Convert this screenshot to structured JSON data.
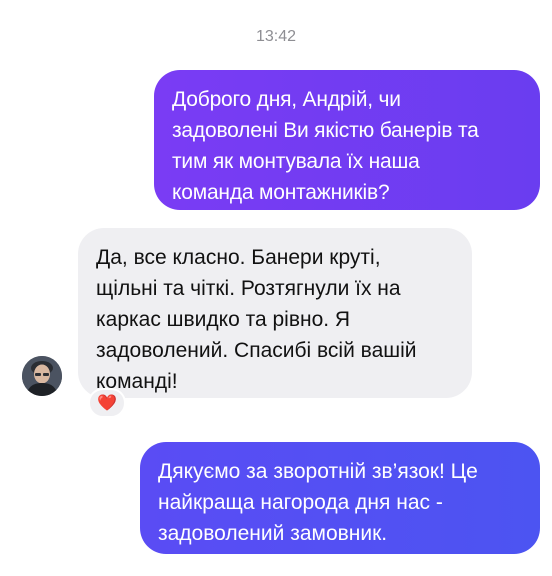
{
  "timestamp": "13:42",
  "messages": [
    {
      "direction": "outgoing",
      "text": "Доброго дня, Андрій, чи\nзадоволені Ви якістю банерів та\nтим як монтувала їх наша\nкоманда монтажників?"
    },
    {
      "direction": "incoming",
      "text": "Да, все класно. Банери круті,\nщільні та чіткі. Розтягнули їх на\nкаркас швидко та рівно. Я\nзадоволений. Спасибі всій вашій\nкоманді!",
      "reaction_icon": "heart-icon",
      "reaction_glyph": "❤️"
    },
    {
      "direction": "outgoing",
      "text": "Дякуємо за зворотній зв’язок! Це\nнайкраща нагорода дня нас -\nзадоволений замовник."
    }
  ],
  "colors": {
    "outgoing_1": "#7a3cf4",
    "outgoing_2": "#5a4cf4",
    "incoming": "#efeff2",
    "timestamp": "#8e8e93"
  }
}
